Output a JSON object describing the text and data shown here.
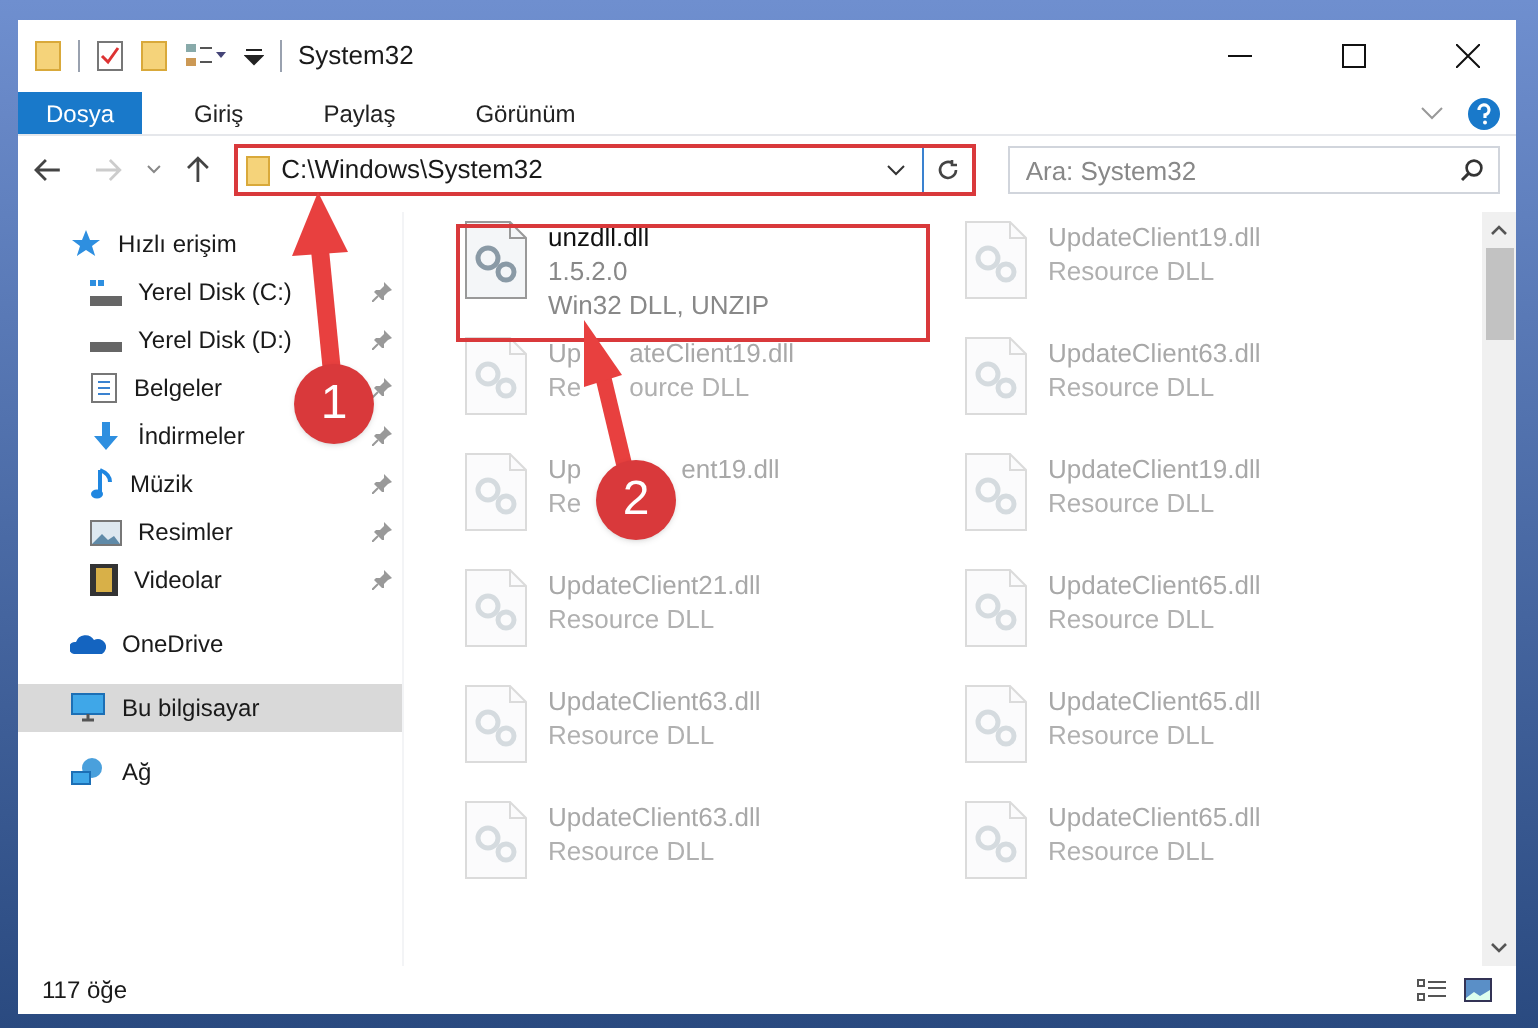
{
  "window": {
    "title": "System32"
  },
  "ribbon_tabs": [
    {
      "label": "Dosya",
      "selected": true
    },
    {
      "label": "Giriş",
      "selected": false
    },
    {
      "label": "Paylaş",
      "selected": false
    },
    {
      "label": "Görünüm",
      "selected": false
    }
  ],
  "address_bar": {
    "path": "C:\\Windows\\System32"
  },
  "search": {
    "placeholder": "Ara: System32"
  },
  "sidebar": {
    "items": [
      {
        "label": "Hızlı erişim",
        "selected": false,
        "children": [
          {
            "label": "Yerel Disk (C:)",
            "pinned": true
          },
          {
            "label": "Yerel Disk (D:)",
            "pinned": true
          },
          {
            "label": "Belgeler",
            "pinned": true
          },
          {
            "label": "İndirmeler",
            "pinned": true
          },
          {
            "label": "Müzik",
            "pinned": true
          },
          {
            "label": "Resimler",
            "pinned": true
          },
          {
            "label": "Videolar",
            "pinned": true
          }
        ]
      },
      {
        "label": "OneDrive",
        "selected": false
      },
      {
        "label": "Bu bilgisayar",
        "selected": true
      },
      {
        "label": "Ağ",
        "selected": false
      }
    ]
  },
  "files": [
    {
      "name": [
        "unzdll.dll"
      ],
      "details": [
        [
          "1.5.2.0"
        ],
        [
          "Win32 DLL, UNZIP"
        ]
      ],
      "blurred": false
    },
    {
      "name": [
        "UpdateClient19.dll"
      ],
      "details": [
        [
          "Resource DLL"
        ]
      ],
      "blurred": true
    },
    {
      "name": [
        "Up",
        "ateClient19.dll"
      ],
      "details": [
        [
          "Re",
          "ource DLL"
        ]
      ],
      "blurred": true
    },
    {
      "name": [
        "UpdateClient63.dll"
      ],
      "details": [
        [
          "Resource DLL"
        ]
      ],
      "blurred": true
    },
    {
      "name": [
        "Up",
        "ent19.dll"
      ],
      "details": [
        [
          "Re"
        ]
      ],
      "blurred": true
    },
    {
      "name": [
        "UpdateClient19.dll"
      ],
      "details": [
        [
          "Resource DLL"
        ]
      ],
      "blurred": true
    },
    {
      "name": [
        "UpdateClient21.dll"
      ],
      "details": [
        [
          "Resource DLL"
        ]
      ],
      "blurred": true
    },
    {
      "name": [
        "UpdateClient65.dll"
      ],
      "details": [
        [
          "Resource DLL"
        ]
      ],
      "blurred": true
    },
    {
      "name": [
        "UpdateClient63.dll"
      ],
      "details": [
        [
          "Resource DLL"
        ]
      ],
      "blurred": true
    },
    {
      "name": [
        "UpdateClient65.dll"
      ],
      "details": [
        [
          "Resource DLL"
        ]
      ],
      "blurred": true
    },
    {
      "name": [
        "UpdateClient63.dll"
      ],
      "details": [
        [
          "Resource DLL"
        ]
      ],
      "blurred": true
    },
    {
      "name": [
        "UpdateClient65.dll"
      ],
      "details": [
        [
          "Resource DLL"
        ]
      ],
      "blurred": true
    }
  ],
  "status_bar": {
    "item_count": "117 öğe"
  },
  "callouts": [
    {
      "number": "1"
    },
    {
      "number": "2"
    }
  ]
}
